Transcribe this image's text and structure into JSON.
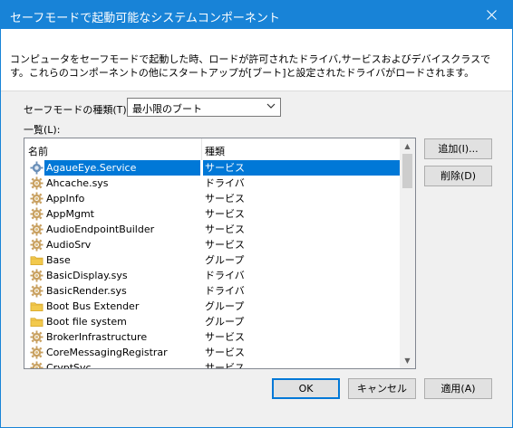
{
  "window": {
    "title": "セーフモードで起動可能なシステムコンポーネント",
    "description": "コンピュータをセーフモードで起動した時、ロードが許可されたドライバ,サービスおよびデバイスクラスです。これらのコンポーネントの他にスタートアップが[ブート]と設定されたドライバがロードされます。"
  },
  "mode": {
    "label": "セーフモードの種類(T):",
    "selected": "最小限のブート"
  },
  "list": {
    "label": "一覧(L):",
    "col_name": "名前",
    "col_type": "種類",
    "rows": [
      {
        "name": "AgaueEye.Service",
        "type": "サービス",
        "icon": "gear-icon",
        "selected": true
      },
      {
        "name": "Ahcache.sys",
        "type": "ドライバ",
        "icon": "gear-icon"
      },
      {
        "name": "AppInfo",
        "type": "サービス",
        "icon": "gear-icon"
      },
      {
        "name": "AppMgmt",
        "type": "サービス",
        "icon": "gear-icon"
      },
      {
        "name": "AudioEndpointBuilder",
        "type": "サービス",
        "icon": "gear-icon"
      },
      {
        "name": "AudioSrv",
        "type": "サービス",
        "icon": "gear-icon"
      },
      {
        "name": "Base",
        "type": "グループ",
        "icon": "folder-icon"
      },
      {
        "name": "BasicDisplay.sys",
        "type": "ドライバ",
        "icon": "gear-icon"
      },
      {
        "name": "BasicRender.sys",
        "type": "ドライバ",
        "icon": "gear-icon"
      },
      {
        "name": "Boot Bus Extender",
        "type": "グループ",
        "icon": "folder-icon"
      },
      {
        "name": "Boot file system",
        "type": "グループ",
        "icon": "folder-icon"
      },
      {
        "name": "BrokerInfrastructure",
        "type": "サービス",
        "icon": "gear-icon"
      },
      {
        "name": "CoreMessagingRegistrar",
        "type": "サービス",
        "icon": "gear-icon"
      },
      {
        "name": "CryptSvc",
        "type": "サービス",
        "icon": "gear-icon"
      }
    ]
  },
  "buttons": {
    "add": "追加(I)...",
    "delete": "削除(D)",
    "ok": "OK",
    "cancel": "キャンセル",
    "apply": "適用(A)"
  },
  "colors": {
    "titlebar": "#1883d7",
    "selection": "#0078d7"
  }
}
